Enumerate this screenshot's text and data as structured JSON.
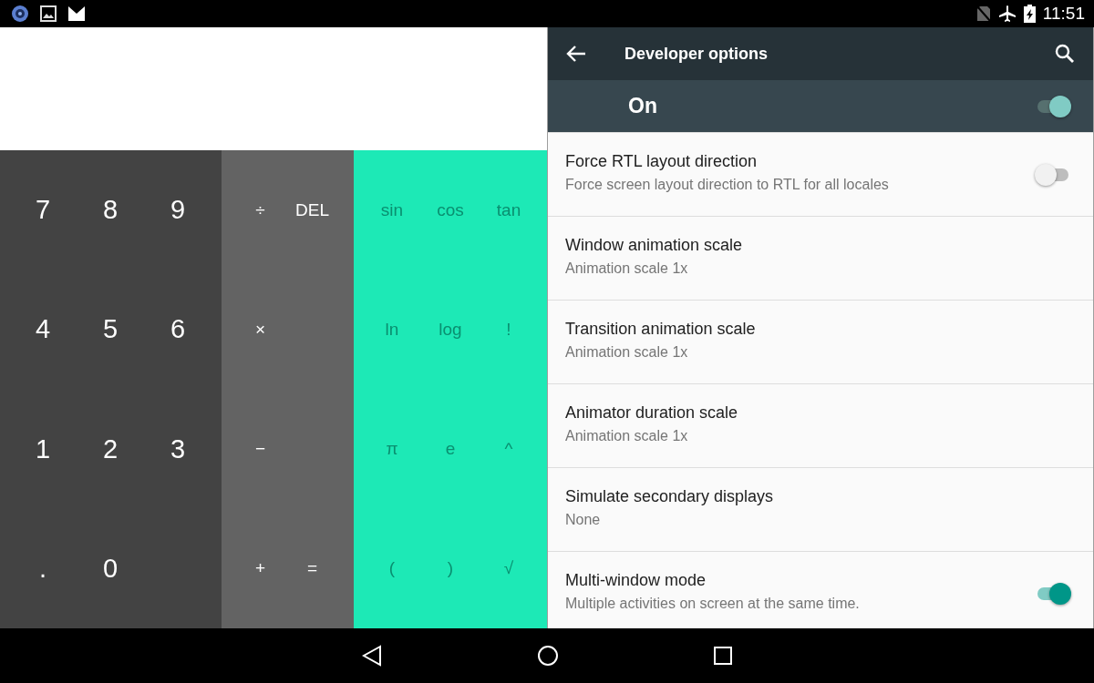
{
  "status_bar": {
    "time": "11:51"
  },
  "calculator": {
    "digit_rows": [
      [
        "7",
        "8",
        "9"
      ],
      [
        "4",
        "5",
        "6"
      ],
      [
        "1",
        "2",
        "3"
      ],
      [
        ".",
        "0"
      ]
    ],
    "operator_rows": [
      [
        "÷",
        "DEL"
      ],
      [
        "×"
      ],
      [
        "−"
      ],
      [
        "+",
        "="
      ]
    ],
    "function_rows": [
      [
        "sin",
        "cos",
        "tan"
      ],
      [
        "ln",
        "log",
        "!"
      ],
      [
        "π",
        "e",
        "^"
      ],
      [
        "(",
        ")",
        "√"
      ]
    ]
  },
  "settings": {
    "title": "Developer options",
    "master": {
      "label": "On",
      "on": true
    },
    "items": [
      {
        "title": "Force RTL layout direction",
        "summary": "Force screen layout direction to RTL for all locales",
        "kind": "switch",
        "checked": false
      },
      {
        "title": "Window animation scale",
        "summary": "Animation scale 1x",
        "kind": "plain"
      },
      {
        "title": "Transition animation scale",
        "summary": "Animation scale 1x",
        "kind": "plain"
      },
      {
        "title": "Animator duration scale",
        "summary": "Animation scale 1x",
        "kind": "plain"
      },
      {
        "title": "Simulate secondary displays",
        "summary": "None",
        "kind": "plain"
      },
      {
        "title": "Multi-window mode",
        "summary": "Multiple activities on screen at the same time.",
        "kind": "switch",
        "checked": true
      }
    ]
  }
}
